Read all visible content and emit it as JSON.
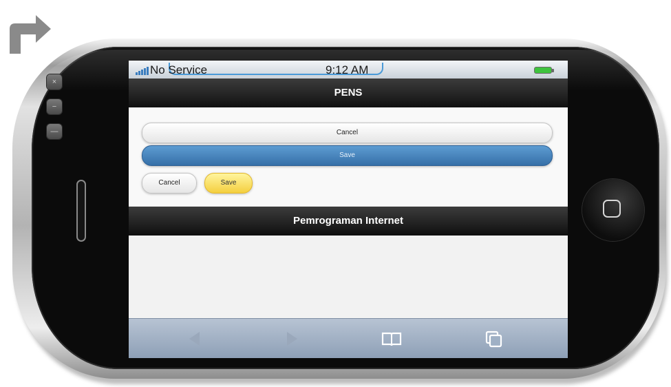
{
  "device": {
    "side_buttons": [
      "×",
      "−",
      "—"
    ],
    "home_button_icon": "home-button-icon"
  },
  "statusbar": {
    "carrier": "No Service",
    "time": "9:12 AM",
    "signal_icon": "signal-bars-icon",
    "battery_icon": "battery-icon",
    "battery_color": "#3ec33e"
  },
  "header": {
    "title": "PENS"
  },
  "content": {
    "cancel_full_label": "Cancel",
    "save_full_label": "Save",
    "cancel_inline_label": "Cancel",
    "save_inline_label": "Save"
  },
  "footer": {
    "title": "Pemrograman Internet"
  },
  "toolbar": {
    "back_icon": "back-arrow-icon",
    "forward_icon": "forward-arrow-icon",
    "bookmarks_icon": "bookmarks-book-icon",
    "pages_icon": "pages-icon"
  },
  "colors": {
    "header_bg": "#1c1c1c",
    "save_blue": "#4a86c0",
    "save_yellow": "#f9dc52",
    "toolbar_bg": "#a3b2c6"
  }
}
